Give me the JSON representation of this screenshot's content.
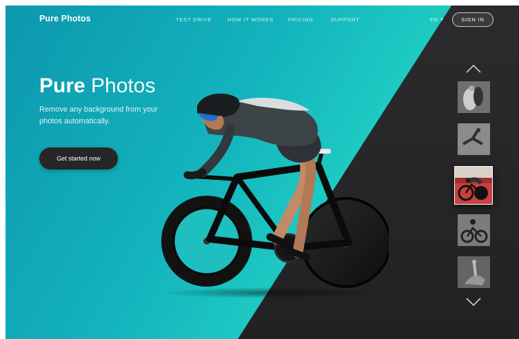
{
  "brand": {
    "name": "Pure Photos"
  },
  "nav": {
    "links": [
      {
        "label": "TEST DRIVE"
      },
      {
        "label": "HOW IT WORKS"
      },
      {
        "label": "PRICING"
      },
      {
        "label": "SUPPORT"
      }
    ],
    "language": "EN",
    "signin_label": "SIGN IN"
  },
  "hero": {
    "title_bold": "Pure",
    "title_light": "Photos",
    "subtitle": "Remove any background from your photos automatically.",
    "cta_label": "Get started now"
  },
  "gallery": {
    "thumbnails": [
      {
        "subject": "wedding-couple-photo",
        "active": false
      },
      {
        "subject": "runner-photo",
        "active": false
      },
      {
        "subject": "cyclist-photo",
        "active": true
      },
      {
        "subject": "mountain-biker-photo",
        "active": false
      },
      {
        "subject": "dancer-photo",
        "active": false
      }
    ],
    "up_icon": "chevron-up-icon",
    "down_icon": "chevron-down-icon"
  },
  "colors": {
    "teal_start": "#0d97ad",
    "teal_end": "#2ad8c8",
    "dark_panel": "#2b2b2d",
    "button_dark": "#262628"
  }
}
